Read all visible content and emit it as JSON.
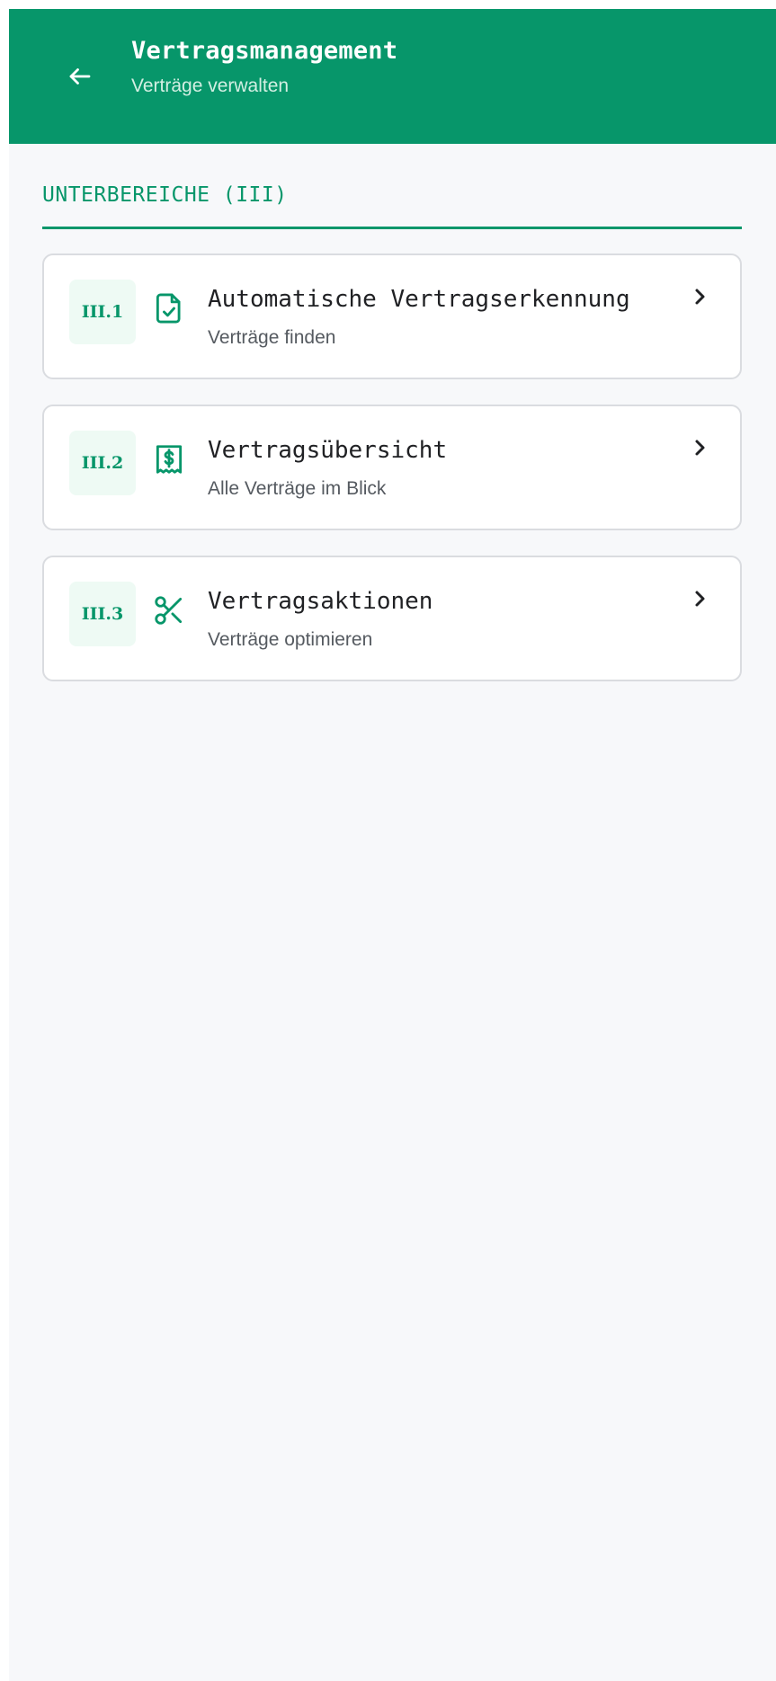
{
  "header": {
    "title": "Vertragsmanagement",
    "subtitle": "Verträge verwalten",
    "back_icon": "arrow-left-icon",
    "background_color": "#07966a"
  },
  "section": {
    "title": "UNTERBEREICHE (III)",
    "accent_color": "#07966a"
  },
  "items": [
    {
      "code": "III.1",
      "icon": "file-check-icon",
      "title": "Automatische Vertragserkennung",
      "subtitle": "Verträge finden"
    },
    {
      "code": "III.2",
      "icon": "receipt-dollar-icon",
      "title": "Vertragsübersicht",
      "subtitle": "Alle Verträge im Blick"
    },
    {
      "code": "III.3",
      "icon": "scissors-icon",
      "title": "Vertragsaktionen",
      "subtitle": "Verträge optimieren"
    }
  ]
}
